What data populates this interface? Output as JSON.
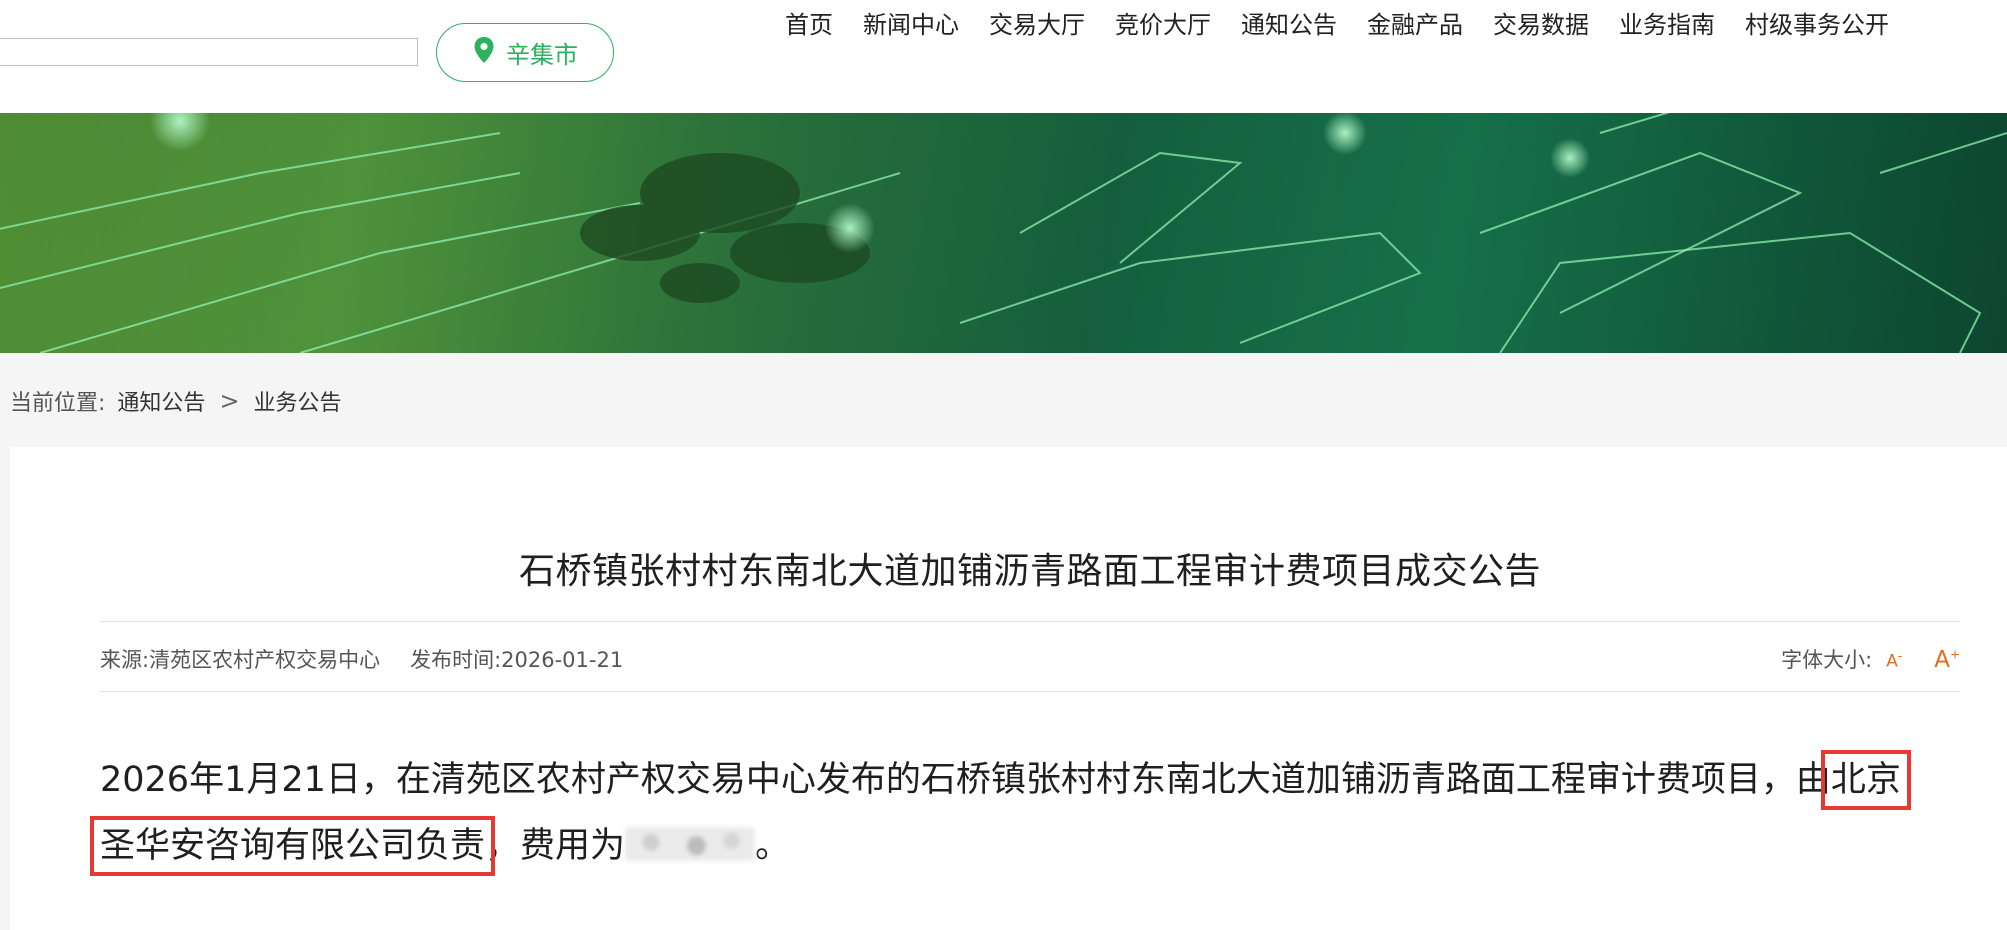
{
  "header": {
    "search": {
      "placeholder": "",
      "value": ""
    },
    "city_button": {
      "label": "辛集市",
      "icon": "location-pin-icon"
    },
    "nav": [
      "首页",
      "新闻中心",
      "交易大厅",
      "竞价大厅",
      "通知公告",
      "金融产品",
      "交易数据",
      "业务指南",
      "村级事务公开"
    ]
  },
  "breadcrumb": {
    "prefix": "当前位置:",
    "items": [
      "通知公告",
      "业务公告"
    ],
    "separator": ">"
  },
  "article": {
    "title": "石桥镇张村村东南北大道加铺沥青路面工程审计费项目成交公告",
    "meta": {
      "source": "来源:清苑区农村产权交易中心",
      "publish_time": "发布时间:2026-01-21"
    },
    "font_size_control": {
      "label": "字体大小:",
      "decrease": "A",
      "increase": "A"
    },
    "body": {
      "part1": "2026年1月21日，在清苑区农村产权交易中心发布的石桥镇张村村东南北大道加铺沥青路面工程审计费项目，由",
      "highlight_a": "北京",
      "highlight_b": "圣华安咨询有限公司负责",
      "part2": "，费用为",
      "part3": "。"
    }
  },
  "colors": {
    "accent_green": "#2bb25d",
    "font_control_orange": "#e46a1e",
    "highlight_red": "#e53935"
  }
}
